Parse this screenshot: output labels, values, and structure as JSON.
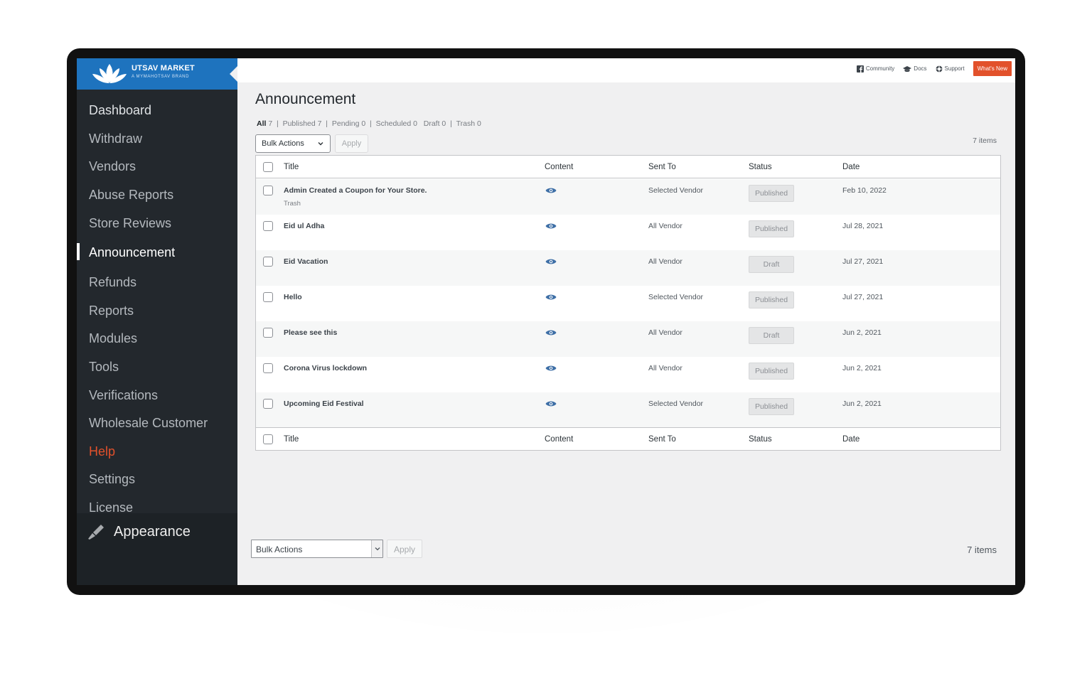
{
  "brand": {
    "name": "UTSAV MARKET",
    "tagline": "A MYMAHOTSAV BRAND",
    "color": "#1e73be"
  },
  "sidebar": {
    "items": [
      {
        "label": "Dashboard"
      },
      {
        "label": "Withdraw"
      },
      {
        "label": "Vendors"
      },
      {
        "label": "Abuse Reports"
      },
      {
        "label": "Store Reviews"
      },
      {
        "label": "Announcement",
        "active": true
      },
      {
        "label": "Refunds"
      },
      {
        "label": "Reports"
      },
      {
        "label": "Modules"
      },
      {
        "label": "Tools"
      },
      {
        "label": "Verifications"
      },
      {
        "label": "Wholesale Customer"
      },
      {
        "label": "Help",
        "highlight": "#e2512b"
      },
      {
        "label": "Settings"
      },
      {
        "label": "License"
      }
    ],
    "appearance": {
      "label": "Appearance",
      "icon": "paintbrush-icon"
    }
  },
  "topbar": {
    "links": [
      {
        "label": "Community",
        "icon": "facebook-icon"
      },
      {
        "label": "Docs",
        "icon": "graduation-cap-icon"
      },
      {
        "label": "Support",
        "icon": "lifebuoy-icon"
      }
    ],
    "whats_new": "What's New",
    "whats_new_color": "#e2512b"
  },
  "page": {
    "title": "Announcement",
    "filters": {
      "all_label": "All",
      "all_count": "7",
      "published": "Published 7",
      "pending": "Pending 0",
      "scheduled": "Scheduled 0",
      "draft": "Draft 0",
      "trash": "Trash 0"
    },
    "bulk_actions": "Bulk Actions",
    "apply": "Apply",
    "items_count": "7 items"
  },
  "table": {
    "columns": {
      "title": "Title",
      "content": "Content",
      "sent_to": "Sent To",
      "status": "Status",
      "date": "Date"
    },
    "rows": [
      {
        "title": "Admin Created a Coupon for Your Store.",
        "sub": "Trash",
        "sent_to": "Selected Vendor",
        "status": "Published",
        "date": "Feb 10, 2022"
      },
      {
        "title": "Eid ul Adha",
        "sub": "",
        "sent_to": "All Vendor",
        "status": "Published",
        "date": "Jul 28, 2021"
      },
      {
        "title": "Eid Vacation",
        "sub": "",
        "sent_to": "All Vendor",
        "status": "Draft",
        "date": "Jul 27, 2021"
      },
      {
        "title": "Hello",
        "sub": "",
        "sent_to": "Selected Vendor",
        "status": "Published",
        "date": "Jul 27, 2021"
      },
      {
        "title": "Please see this",
        "sub": "",
        "sent_to": "All Vendor",
        "status": "Draft",
        "date": "Jun 2, 2021"
      },
      {
        "title": "Corona Virus lockdown",
        "sub": "",
        "sent_to": "All Vendor",
        "status": "Published",
        "date": "Jun 2, 2021"
      },
      {
        "title": "Upcoming Eid Festival",
        "sub": "",
        "sent_to": "Selected Vendor",
        "status": "Published",
        "date": "Jun 2, 2021"
      }
    ]
  }
}
